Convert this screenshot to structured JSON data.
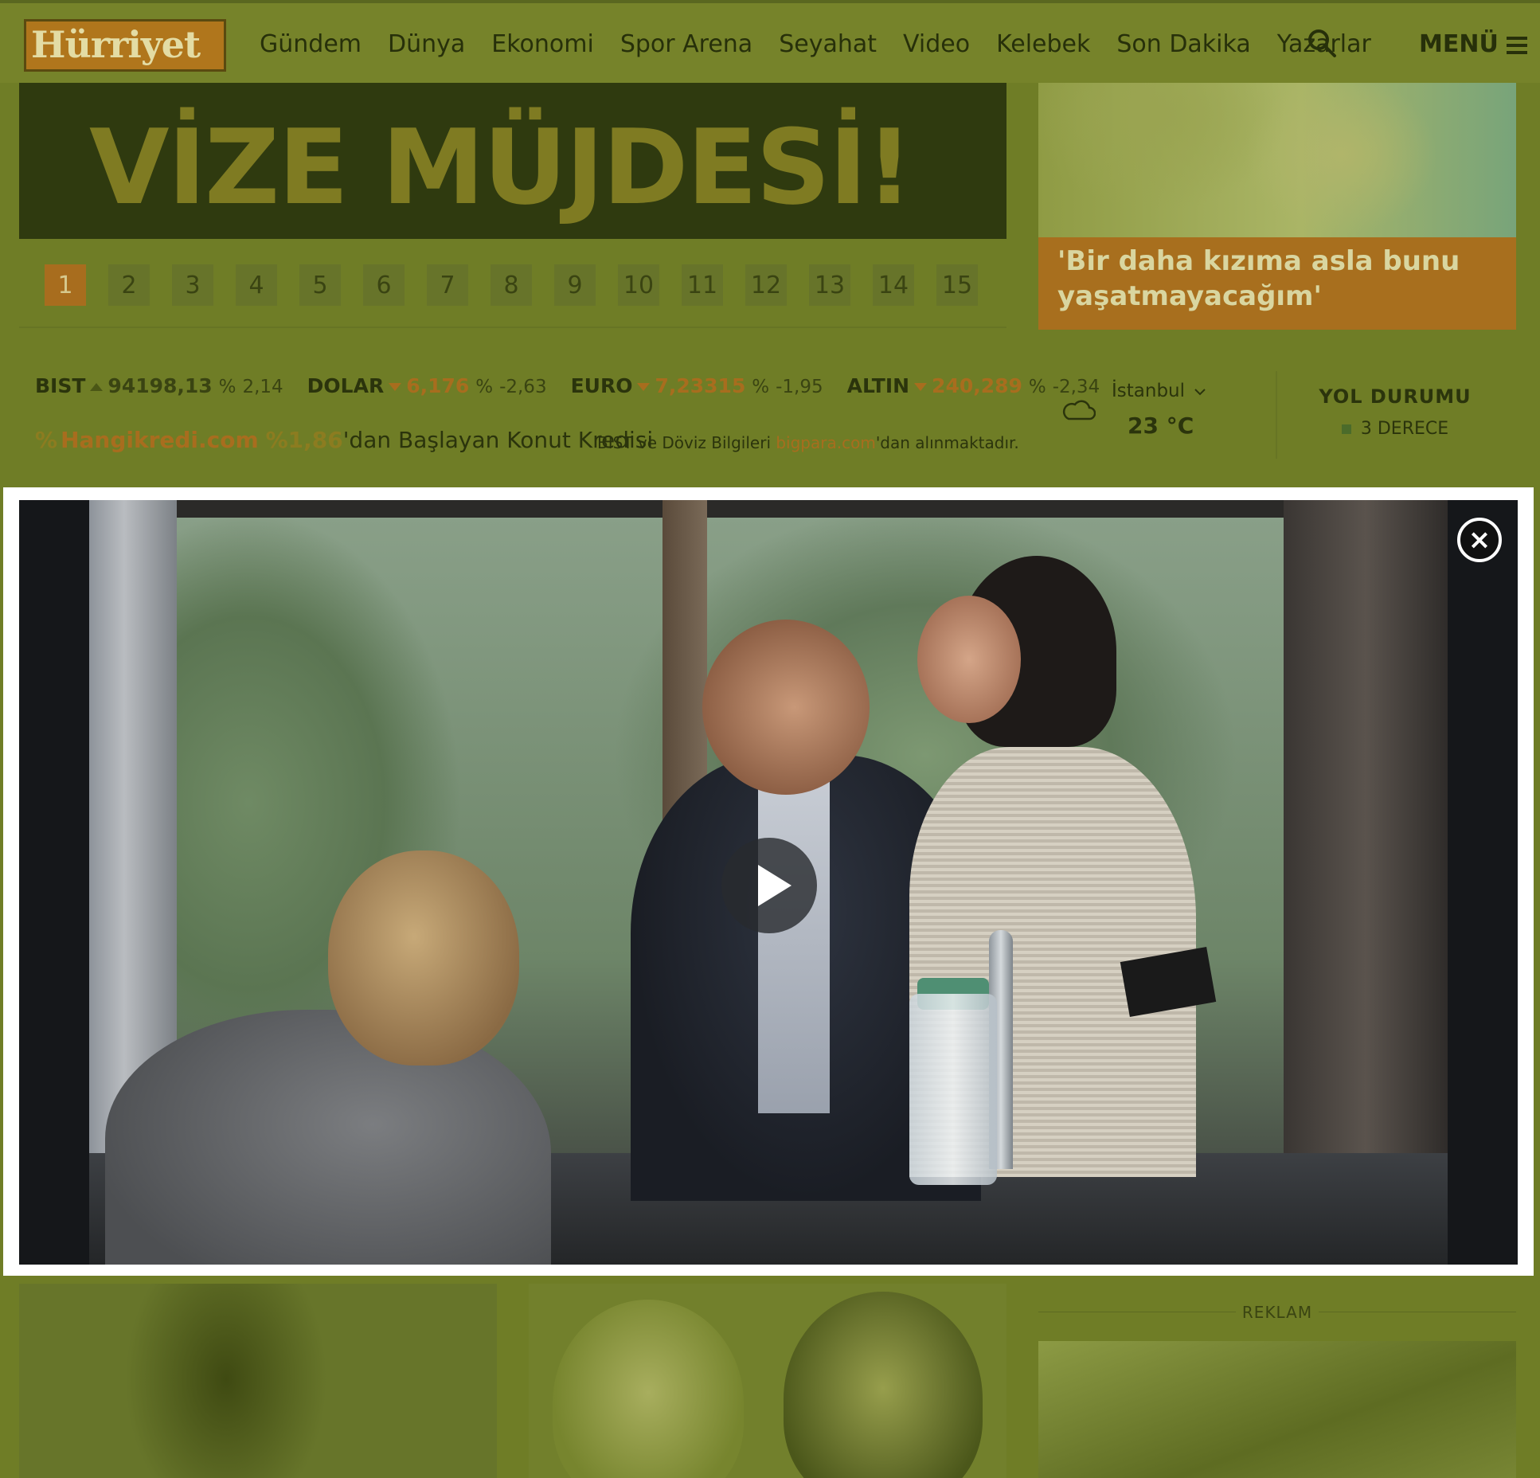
{
  "header": {
    "logo_text": "Hürriyet",
    "nav": [
      "Gündem",
      "Dünya",
      "Ekonomi",
      "Spor Arena",
      "Seyahat",
      "Video",
      "Kelebek",
      "Son Dakika",
      "Yazarlar"
    ],
    "search_icon": "search-icon",
    "menu_label": "MENÜ",
    "menu_icon": "hamburger-icon"
  },
  "banner": {
    "headline": "VİZE MÜJDESİ!"
  },
  "pagination": {
    "pages": [
      "1",
      "2",
      "3",
      "4",
      "5",
      "6",
      "7",
      "8",
      "9",
      "10",
      "11",
      "12",
      "13",
      "14",
      "15"
    ],
    "active": "1"
  },
  "promo": {
    "caption": "'Bir daha kızıma asla bunu yaşatmayacağım'"
  },
  "markets": [
    {
      "name": "BIST",
      "direction": "up",
      "value": "94198,13",
      "pct_sign": "%",
      "pct": "2,14"
    },
    {
      "name": "DOLAR",
      "direction": "down",
      "value": "6,176",
      "pct_sign": "%",
      "pct": "-2,63"
    },
    {
      "name": "EURO",
      "direction": "down",
      "value": "7,23315",
      "pct_sign": "%",
      "pct": "-1,95"
    },
    {
      "name": "ALTIN",
      "direction": "down",
      "value": "240,289",
      "pct_sign": "%",
      "pct": "-2,34"
    }
  ],
  "credit_ad": {
    "brand": "Hangikredi.com",
    "rate": "%1,86",
    "text": "'dan Başlayan Konut Kredisi"
  },
  "data_source": {
    "prefix": "BIST ve Döviz Bilgileri ",
    "link": "bigpara.com",
    "suffix": "'dan alınmaktadır."
  },
  "weather": {
    "city": "İstanbul",
    "temp": "23 °C",
    "icon": "cloud-icon"
  },
  "road": {
    "title": "YOL DURUMU",
    "status": "3 DERECE"
  },
  "ad": {
    "label": "REKLAM"
  },
  "video_modal": {
    "close_label": "×",
    "play_icon": "play-icon"
  },
  "colors": {
    "overlay": "#6f7d26",
    "accent": "#a86d1e",
    "modal_border": "#ffffff"
  }
}
